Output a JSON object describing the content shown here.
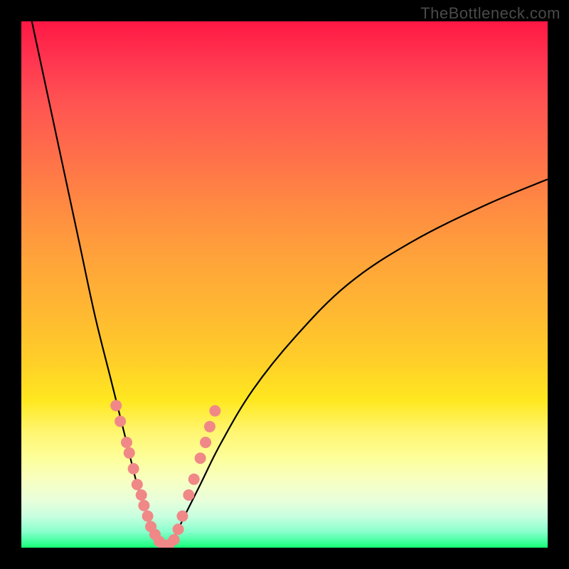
{
  "watermark_text": "TheBottleneck.com",
  "chart_data": {
    "type": "line",
    "title": "",
    "xlabel": "",
    "ylabel": "",
    "xlim": [
      0,
      100
    ],
    "ylim": [
      0,
      100
    ],
    "description": "V-shaped bottleneck curve over a vertical spectrum gradient (red at top = high mismatch, green at bottom = optimal). Two black curves descend from upper corners and meet at the bottom around x≈27. Pink dots mark sample points near the valley.",
    "series": [
      {
        "name": "left-curve",
        "x": [
          2,
          5,
          8,
          11,
          14,
          17,
          20,
          22,
          24,
          26,
          27
        ],
        "y": [
          100,
          86,
          72,
          58,
          44,
          32,
          20,
          12,
          6,
          2,
          0
        ]
      },
      {
        "name": "right-curve",
        "x": [
          27,
          29,
          31,
          34,
          38,
          44,
          52,
          62,
          74,
          88,
          100
        ],
        "y": [
          0,
          2,
          6,
          12,
          20,
          30,
          40,
          50,
          58,
          65,
          70
        ]
      }
    ],
    "dots": [
      {
        "x": 18.0,
        "y": 27
      },
      {
        "x": 18.8,
        "y": 24
      },
      {
        "x": 20.0,
        "y": 20
      },
      {
        "x": 20.5,
        "y": 18
      },
      {
        "x": 21.3,
        "y": 15
      },
      {
        "x": 22.0,
        "y": 12
      },
      {
        "x": 22.8,
        "y": 10
      },
      {
        "x": 23.3,
        "y": 8
      },
      {
        "x": 24.0,
        "y": 6
      },
      {
        "x": 24.6,
        "y": 4
      },
      {
        "x": 25.4,
        "y": 2.5
      },
      {
        "x": 26.2,
        "y": 1.2
      },
      {
        "x": 27.0,
        "y": 0.5
      },
      {
        "x": 28.0,
        "y": 0.5
      },
      {
        "x": 29.0,
        "y": 1.5
      },
      {
        "x": 29.8,
        "y": 3.5
      },
      {
        "x": 30.6,
        "y": 6
      },
      {
        "x": 31.8,
        "y": 10
      },
      {
        "x": 32.8,
        "y": 13
      },
      {
        "x": 34.0,
        "y": 17
      },
      {
        "x": 35.0,
        "y": 20
      },
      {
        "x": 35.8,
        "y": 23
      },
      {
        "x": 36.8,
        "y": 26
      }
    ],
    "gradient_stops": [
      {
        "offset": 0,
        "color": "#ff1744"
      },
      {
        "offset": 50,
        "color": "#ffb832"
      },
      {
        "offset": 100,
        "color": "#15ff72"
      }
    ]
  }
}
